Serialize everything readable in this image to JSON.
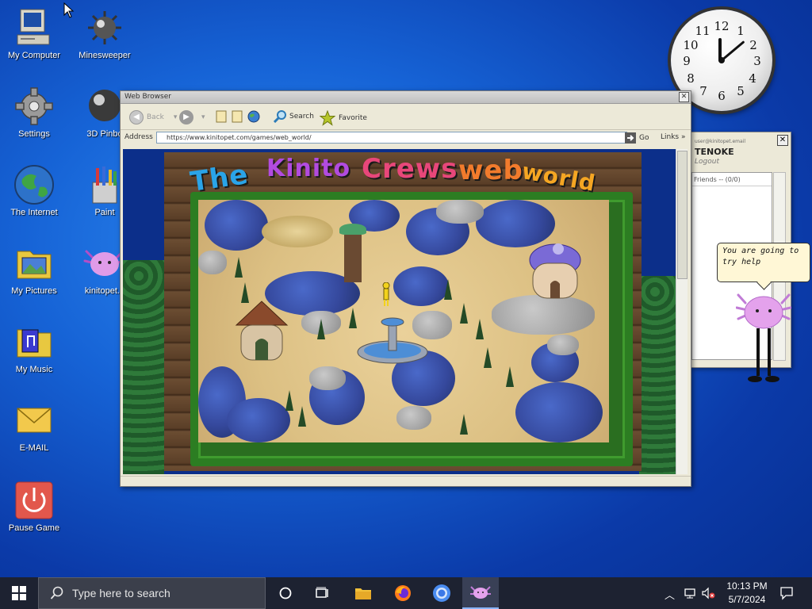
{
  "desktop": {
    "icons": [
      {
        "label": "My Computer",
        "icon": "computer-icon"
      },
      {
        "label": "Minesweeper",
        "icon": "mine-icon"
      },
      {
        "label": "Settings",
        "icon": "gear-icon"
      },
      {
        "label": "3D Pinbo",
        "icon": "pinball-icon"
      },
      {
        "label": "The Internet",
        "icon": "globe-icon"
      },
      {
        "label": "Paint",
        "icon": "paint-icon"
      },
      {
        "label": "My Pictures",
        "icon": "pictures-folder-icon"
      },
      {
        "label": "kinitopet.e",
        "icon": "axolotl-icon"
      },
      {
        "label": "My Music",
        "icon": "music-folder-icon"
      },
      {
        "label": "E-MAIL",
        "icon": "envelope-icon"
      },
      {
        "label": "Pause Game",
        "icon": "power-icon"
      }
    ]
  },
  "clock": {
    "numerals": [
      "12",
      "1",
      "2",
      "3",
      "4",
      "5",
      "6",
      "7",
      "8",
      "9",
      "10",
      "11"
    ]
  },
  "browser": {
    "title": "Web Browser",
    "back_label": "Back",
    "search_label": "Search",
    "favorite_label": "Favorite",
    "address_label": "Address",
    "address_value": "https://www.kinitopet.com/games/web_world/",
    "go_label": "Go",
    "links_label": "Links"
  },
  "game": {
    "title_words": [
      {
        "text": "The",
        "color": "#2aa4e8"
      },
      {
        "text": "Kinito",
        "color": "#b24be0"
      },
      {
        "text": "Crews",
        "color": "#e8477a"
      },
      {
        "text": "web",
        "color": "#f27b2c"
      },
      {
        "text": "world",
        "color": "#f5a623"
      }
    ]
  },
  "messenger": {
    "account_small": "user@kinitopet.email",
    "account_name": "TENOKE",
    "logout_label": "Logout",
    "friends_label": "Friends -- (0/0)"
  },
  "speech": {
    "text": "You are going to try help"
  },
  "taskbar": {
    "search_placeholder": "Type here to search",
    "time": "10:13 PM",
    "date": "5/7/2024"
  }
}
